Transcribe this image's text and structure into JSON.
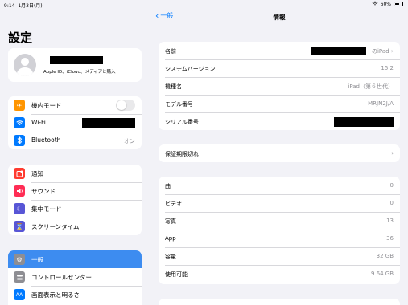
{
  "status_bar": {
    "time": "9:14",
    "date": "1月3日(月)",
    "battery": "60%",
    "battery_level": 0.6
  },
  "sidebar": {
    "title": "設定",
    "profile": {
      "subtitle": "Apple ID、iCloud、メディアと購入"
    },
    "group1": [
      {
        "label": "機内モード",
        "icon": "airplane-icon",
        "color": "#ff9500"
      },
      {
        "label": "Wi-Fi",
        "icon": "wifi-icon",
        "color": "#007aff"
      },
      {
        "label": "Bluetooth",
        "icon": "bluetooth-icon",
        "color": "#007aff",
        "value": "オン"
      }
    ],
    "group2": [
      {
        "label": "通知",
        "icon": "notifications-icon",
        "color": "#ff3b30"
      },
      {
        "label": "サウンド",
        "icon": "sound-icon",
        "color": "#ff2d55"
      },
      {
        "label": "集中モード",
        "icon": "moon-icon",
        "color": "#5856d6"
      },
      {
        "label": "スクリーンタイム",
        "icon": "hourglass-icon",
        "color": "#5856d6"
      }
    ],
    "group3": [
      {
        "label": "一般",
        "icon": "gear-icon",
        "color": "#8e8e93"
      },
      {
        "label": "コントロールセンター",
        "icon": "control-center-icon",
        "color": "#8e8e93"
      },
      {
        "label": "画面表示と明るさ",
        "icon": "display-icon",
        "color": "#007aff"
      }
    ]
  },
  "detail": {
    "back_label": "一般",
    "title": "情報",
    "device_info": {
      "name_label": "名前",
      "name_suffix": "のiPad",
      "system_version_label": "システムバージョン",
      "system_version": "15.2",
      "model_name_label": "機種名",
      "model_name": "iPad（第６世代）",
      "model_number_label": "モデル番号",
      "model_number": "MRJN2J/A",
      "serial_label": "シリアル番号"
    },
    "warranty_label": "保証期限切れ",
    "stats": [
      {
        "label": "曲",
        "value": "0"
      },
      {
        "label": "ビデオ",
        "value": "0"
      },
      {
        "label": "写真",
        "value": "13"
      },
      {
        "label": "App",
        "value": "36"
      },
      {
        "label": "容量",
        "value": "32 GB"
      },
      {
        "label": "使用可能",
        "value": "9.64 GB"
      }
    ]
  }
}
